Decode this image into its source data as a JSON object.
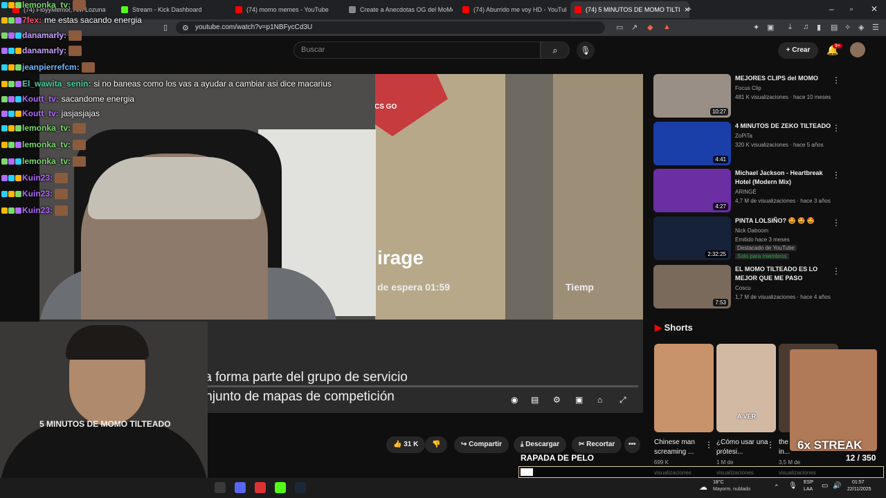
{
  "browser": {
    "tabs": [
      {
        "label": "(74) FloyyMemor, Alvi Lozuna",
        "fav": "#ff0000"
      },
      {
        "label": "Stream - Kick Dashboard",
        "fav": "#53fc18"
      },
      {
        "label": "(74) momo memes - YouTube",
        "fav": "#ff0000"
      },
      {
        "label": "Create a Anecdotas OG del MoMo T",
        "fav": "#888888"
      },
      {
        "label": "(74) Aburrido me voy HD - YouTube",
        "fav": "#ff0000"
      },
      {
        "label": "(74) 5 MINUTOS DE MOMO TILTI",
        "fav": "#ff0000"
      }
    ],
    "new_tab": "+",
    "url": "youtube.com/watch?v=p1NBFycCd3U"
  },
  "yt_header": {
    "search_placeholder": "Buscar",
    "create_label": "Crear",
    "notif_count": "9+"
  },
  "chat": [
    {
      "user": "lemonka_tv:",
      "msg": "",
      "color": "#7cd96d"
    },
    {
      "user": "7fex:",
      "msg": "me estas sacando energia",
      "color": "#ff4d6d"
    },
    {
      "user": "danamarly:",
      "msg": "",
      "color": "#c9a0ff"
    },
    {
      "user": "danamarly:",
      "msg": "",
      "color": "#c9a0ff"
    },
    {
      "user": "jeanpierrefcm:",
      "msg": "",
      "color": "#6fb7ff"
    },
    {
      "user": "El_wawita_senin:",
      "msg": "si no baneas como los vas a ayudar a cambiar asi dice macarius",
      "color": "#4fd1a5"
    },
    {
      "user": "Koutt_tv:",
      "msg": "sacandome energia",
      "color": "#b06bff"
    },
    {
      "user": "Koutt_tv:",
      "msg": "jasjasjajas",
      "color": "#b06bff"
    },
    {
      "user": "lemonka_tv:",
      "msg": "",
      "color": "#7cd96d"
    },
    {
      "user": "lemonka_tv:",
      "msg": "",
      "color": "#7cd96d"
    },
    {
      "user": "lemonka_tv:",
      "msg": "",
      "color": "#7cd96d"
    },
    {
      "user": "Kuin23:",
      "msg": "",
      "color": "#b06bff"
    },
    {
      "user": "Kuin23:",
      "msg": "",
      "color": "#b06bff"
    },
    {
      "user": "Kuin23:",
      "msg": "",
      "color": "#b06bff"
    }
  ],
  "player": {
    "sign_text": "CS GO",
    "map_name": "irage",
    "wait_text": "de espera 01:59",
    "right_text": "Tiemp",
    "subtitle_1": "Este mapa forma parte del grupo de servicio",
    "subtitle_2": "activo (conjunto de mapas de competición"
  },
  "video": {
    "title_partial": "5 MINUTOS DE MOMO TILTEADO",
    "likes": "31 K",
    "share": "Compartir",
    "download": "Descargar",
    "clip": "Recortar"
  },
  "sidebar": {
    "videos": [
      {
        "title": "MEJORES CLIPS del MOMO",
        "channel": "Focus Clip",
        "meta": "481 K visualizaciones · hace 10 meses",
        "duration": "10:27",
        "thumb": "#9a8f86"
      },
      {
        "title": "4 MINUTOS DE ZEKO TILTEADO",
        "channel": "ZoPiTa",
        "meta": "320 K visualizaciones · hace 5 años",
        "duration": "4:41",
        "thumb": "#1a3fa8"
      },
      {
        "title": "Michael Jackson - Heartbreak Hotel (Modern Mix)",
        "channel": "ARINGÉ",
        "meta": "4,7 M de visualizaciones · hace 3 años",
        "duration": "4:27",
        "thumb": "#6b2ea3"
      },
      {
        "title": "PINTA LOLSIÑO? 🤩 🤩 🤩",
        "channel": "Nick Daboom",
        "meta": "Emitido hace 3 meses",
        "badge1": "Destacado de YouTube",
        "badge2": "Solo para miembros",
        "duration": "2:32:25",
        "thumb": "#152238"
      },
      {
        "title": "EL MOMO TILTEADO ES LO MEJOR QUE ME PASO",
        "channel": "Coscu",
        "meta": "1,7 M de visualizaciones · hace 4 años",
        "duration": "7:53",
        "thumb": "#7a6a5c"
      }
    ],
    "shorts_header": "Shorts",
    "shorts": [
      {
        "title": "Chinese man screaming ...",
        "views": "699 K",
        "views2": "visualizaciones",
        "thumb": "#c8926a",
        "label": ""
      },
      {
        "title": "¿Cómo usar una prótesi...",
        "views": "1 M de",
        "views2": "visualizaciones",
        "thumb": "#d2b9a4",
        "label": "A VER"
      },
      {
        "title": "the best laughs in...",
        "views": "3,5 M de",
        "views2": "visualizaciones",
        "thumb": "#4a3a30",
        "label": ""
      }
    ]
  },
  "overlay": {
    "streak": "6x STREAK",
    "goal_title": "RAPADA DE PELO",
    "count": "12  / 350",
    "progress": 0.034
  },
  "taskbar": {
    "weather_temp": "18°C",
    "weather_desc": "Mayorm. nublado",
    "lang1": "ESP",
    "lang2": "LAA",
    "time": "01:57",
    "date": "22/11/2025"
  },
  "colors": {
    "yt_red": "#ff0000",
    "accent": "#3ea6ff"
  }
}
